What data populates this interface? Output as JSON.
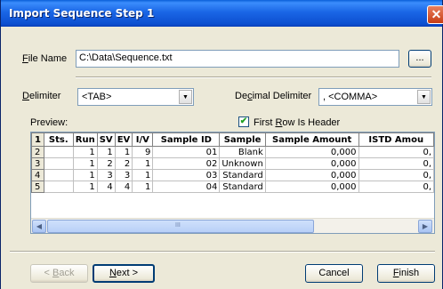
{
  "window": {
    "title": "Import Sequence Step 1",
    "close_icon": "close-icon"
  },
  "file": {
    "label": "File Name",
    "value": "C:\\Data\\Sequence.txt",
    "browse_label": "..."
  },
  "delimiter": {
    "label": "Delimiter",
    "value": "<TAB>"
  },
  "decimal_delimiter": {
    "label": "Decimal Delimiter",
    "value": ", <COMMA>"
  },
  "preview_label": "Preview:",
  "first_row_header": {
    "label": "First Row Is Header",
    "checked": true
  },
  "grid": {
    "columns": [
      "1",
      "Sts.",
      "Run",
      "SV",
      "EV",
      "I/V",
      "Sample ID",
      "Sample",
      "Sample Amount",
      "ISTD Amou"
    ],
    "rows": [
      [
        "2",
        "",
        "1",
        "1",
        "1",
        "9",
        "01",
        "Blank",
        "0,000",
        "0,"
      ],
      [
        "3",
        "",
        "1",
        "2",
        "2",
        "1",
        "02",
        "Unknown",
        "0,000",
        "0,"
      ],
      [
        "4",
        "",
        "1",
        "3",
        "3",
        "1",
        "03",
        "Standard",
        "0,000",
        "0,"
      ],
      [
        "5",
        "",
        "1",
        "4",
        "4",
        "1",
        "04",
        "Standard",
        "0,000",
        "0,"
      ]
    ]
  },
  "scrollbar": {
    "thumb_grip": "III"
  },
  "buttons": {
    "back": "< Back",
    "next": "Next >",
    "cancel": "Cancel",
    "finish": "Finish"
  }
}
